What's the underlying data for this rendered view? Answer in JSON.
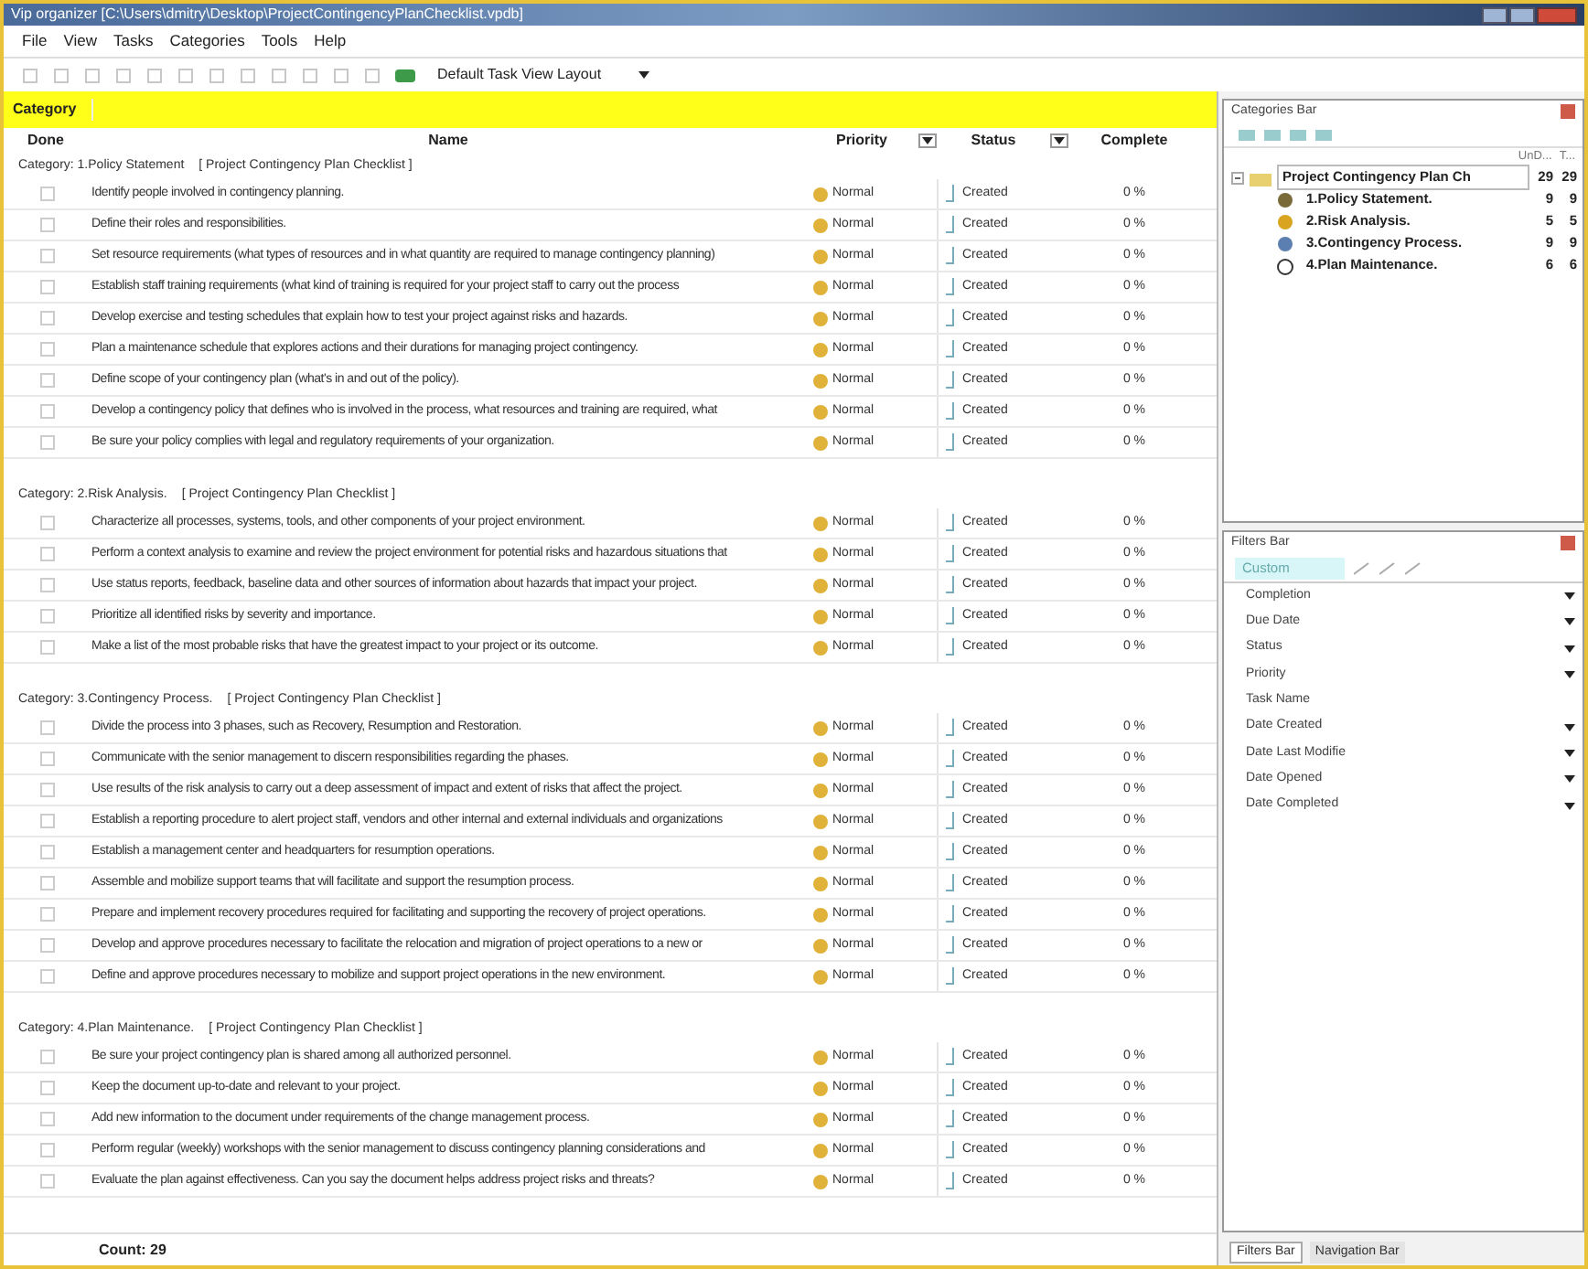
{
  "window": {
    "title": "Vip organizer [C:\\Users\\dmitry\\Desktop\\ProjectContingencyPlanChecklist.vpdb]"
  },
  "menu": [
    "File",
    "View",
    "Tasks",
    "Categories",
    "Tools",
    "Help"
  ],
  "toolbar": {
    "layout": "Default Task View Layout"
  },
  "group_bar": {
    "label": "Category"
  },
  "columns": [
    "Done",
    "Name",
    "Priority",
    "Status",
    "Complete"
  ],
  "groups": [
    {
      "title": "Category: 1.Policy Statement",
      "list": "[ Project Contingency Plan Checklist ]",
      "tasks": [
        {
          "done": false,
          "name": "Identify people involved in contingency planning.",
          "priority": "Normal",
          "status": "Created",
          "complete": "0 %"
        },
        {
          "done": false,
          "name": "Define their roles and responsibilities.",
          "priority": "Normal",
          "status": "Created",
          "complete": "0 %"
        },
        {
          "done": false,
          "name": "Set resource requirements (what types of resources and in what quantity are required to manage contingency planning)",
          "priority": "Normal",
          "status": "Created",
          "complete": "0 %"
        },
        {
          "done": false,
          "name": "Establish staff training requirements (what kind of training is required for your project staff to carry out the process",
          "priority": "Normal",
          "status": "Created",
          "complete": "0 %"
        },
        {
          "done": false,
          "name": "Develop exercise and testing schedules that explain how to test your project against risks and hazards.",
          "priority": "Normal",
          "status": "Created",
          "complete": "0 %"
        },
        {
          "done": false,
          "name": "Plan a maintenance schedule that explores actions and their durations for managing project contingency.",
          "priority": "Normal",
          "status": "Created",
          "complete": "0 %"
        },
        {
          "done": false,
          "name": "Define scope of your contingency plan (what's in and out of the policy).",
          "priority": "Normal",
          "status": "Created",
          "complete": "0 %"
        },
        {
          "done": false,
          "name": "Develop a contingency policy that defines who is involved in the process, what resources and training are required, what",
          "priority": "Normal",
          "status": "Created",
          "complete": "0 %"
        },
        {
          "done": false,
          "name": "Be sure your policy complies with legal and regulatory requirements of your organization.",
          "priority": "Normal",
          "status": "Created",
          "complete": "0 %"
        }
      ]
    },
    {
      "title": "Category: 2.Risk Analysis.",
      "list": "[ Project Contingency Plan Checklist ]",
      "tasks": [
        {
          "done": false,
          "name": "Characterize all processes, systems, tools, and other components of your project environment.",
          "priority": "Normal",
          "status": "Created",
          "complete": "0 %"
        },
        {
          "done": false,
          "name": "Perform a context analysis to examine and review the project environment for potential risks and hazardous situations that",
          "priority": "Normal",
          "status": "Created",
          "complete": "0 %"
        },
        {
          "done": false,
          "name": "Use status reports, feedback, baseline data and other sources of information about hazards that impact your project.",
          "priority": "Normal",
          "status": "Created",
          "complete": "0 %"
        },
        {
          "done": false,
          "name": "Prioritize all identified risks by severity and importance.",
          "priority": "Normal",
          "status": "Created",
          "complete": "0 %"
        },
        {
          "done": false,
          "name": "Make a list of the most probable risks that have the greatest impact to your project or its outcome.",
          "priority": "Normal",
          "status": "Created",
          "complete": "0 %"
        }
      ]
    },
    {
      "title": "Category: 3.Contingency Process.",
      "list": "[ Project Contingency Plan Checklist ]",
      "tasks": [
        {
          "done": false,
          "name": "Divide the process into 3 phases, such as Recovery, Resumption and Restoration.",
          "priority": "Normal",
          "status": "Created",
          "complete": "0 %"
        },
        {
          "done": false,
          "name": "Communicate with the senior management to discern responsibilities regarding the phases.",
          "priority": "Normal",
          "status": "Created",
          "complete": "0 %"
        },
        {
          "done": false,
          "name": "Use results of the risk analysis to carry out a deep assessment of impact and extent of risks that affect the project.",
          "priority": "Normal",
          "status": "Created",
          "complete": "0 %"
        },
        {
          "done": false,
          "name": "Establish a reporting procedure to alert project staff, vendors and other internal and external individuals and organizations",
          "priority": "Normal",
          "status": "Created",
          "complete": "0 %"
        },
        {
          "done": false,
          "name": "Establish a management center and headquarters for resumption operations.",
          "priority": "Normal",
          "status": "Created",
          "complete": "0 %"
        },
        {
          "done": false,
          "name": "Assemble and mobilize support teams that will facilitate and support the resumption process.",
          "priority": "Normal",
          "status": "Created",
          "complete": "0 %"
        },
        {
          "done": false,
          "name": "Prepare and implement recovery procedures required for facilitating and supporting the recovery of project operations.",
          "priority": "Normal",
          "status": "Created",
          "complete": "0 %"
        },
        {
          "done": false,
          "name": "Develop and approve procedures necessary to facilitate the relocation and migration of project operations to a new or",
          "priority": "Normal",
          "status": "Created",
          "complete": "0 %"
        },
        {
          "done": false,
          "name": "Define and approve procedures necessary to mobilize and support project operations in the new environment.",
          "priority": "Normal",
          "status": "Created",
          "complete": "0 %"
        }
      ]
    },
    {
      "title": "Category: 4.Plan Maintenance.",
      "list": "[ Project Contingency Plan Checklist ]",
      "tasks": [
        {
          "done": false,
          "name": "Be sure your project contingency plan is shared among all authorized personnel.",
          "priority": "Normal",
          "status": "Created",
          "complete": "0 %"
        },
        {
          "done": false,
          "name": "Keep the document up-to-date and relevant to your project.",
          "priority": "Normal",
          "status": "Created",
          "complete": "0 %"
        },
        {
          "done": false,
          "name": "Add new information to the document under requirements of the change management process.",
          "priority": "Normal",
          "status": "Created",
          "complete": "0 %"
        },
        {
          "done": false,
          "name": "Perform regular (weekly) workshops with the senior management to discuss contingency planning considerations and",
          "priority": "Normal",
          "status": "Created",
          "complete": "0 %"
        },
        {
          "done": false,
          "name": "Evaluate the plan against effectiveness. Can you say the document helps address project risks and threats?",
          "priority": "Normal",
          "status": "Created",
          "complete": "0 %"
        }
      ]
    }
  ],
  "count": "Count: 29",
  "categories_bar": {
    "title": "Categories Bar",
    "columns": [
      "UnD...",
      "T..."
    ],
    "root": {
      "name": "Project Contingency Plan Ch",
      "undone": "29",
      "total": "29",
      "expanded": true,
      "selected": true,
      "children": [
        {
          "name": "1.Policy Statement.",
          "undone": "9",
          "total": "9",
          "selected": false
        },
        {
          "name": "2.Risk Analysis.",
          "undone": "5",
          "total": "5",
          "selected": false
        },
        {
          "name": "3.Contingency Process.",
          "undone": "9",
          "total": "9",
          "selected": false
        },
        {
          "name": "4.Plan Maintenance.",
          "undone": "6",
          "total": "6",
          "selected": false
        }
      ]
    }
  },
  "filters_bar": {
    "title": "Filters Bar",
    "preset": "Custom",
    "filters": [
      {
        "label": "Completion",
        "dropdown": true
      },
      {
        "label": "Due Date",
        "dropdown": true
      },
      {
        "label": "Status",
        "dropdown": true
      },
      {
        "label": "Priority",
        "dropdown": true
      },
      {
        "label": "Task Name",
        "dropdown": false
      },
      {
        "label": "Date Created",
        "dropdown": true
      },
      {
        "label": "Date Last Modifie",
        "dropdown": true
      },
      {
        "label": "Date Opened",
        "dropdown": true
      },
      {
        "label": "Date Completed",
        "dropdown": true
      }
    ]
  },
  "bottom_tabs": [
    {
      "label": "Filters Bar",
      "selected": true
    },
    {
      "label": "Navigation Bar",
      "selected": false
    }
  ]
}
